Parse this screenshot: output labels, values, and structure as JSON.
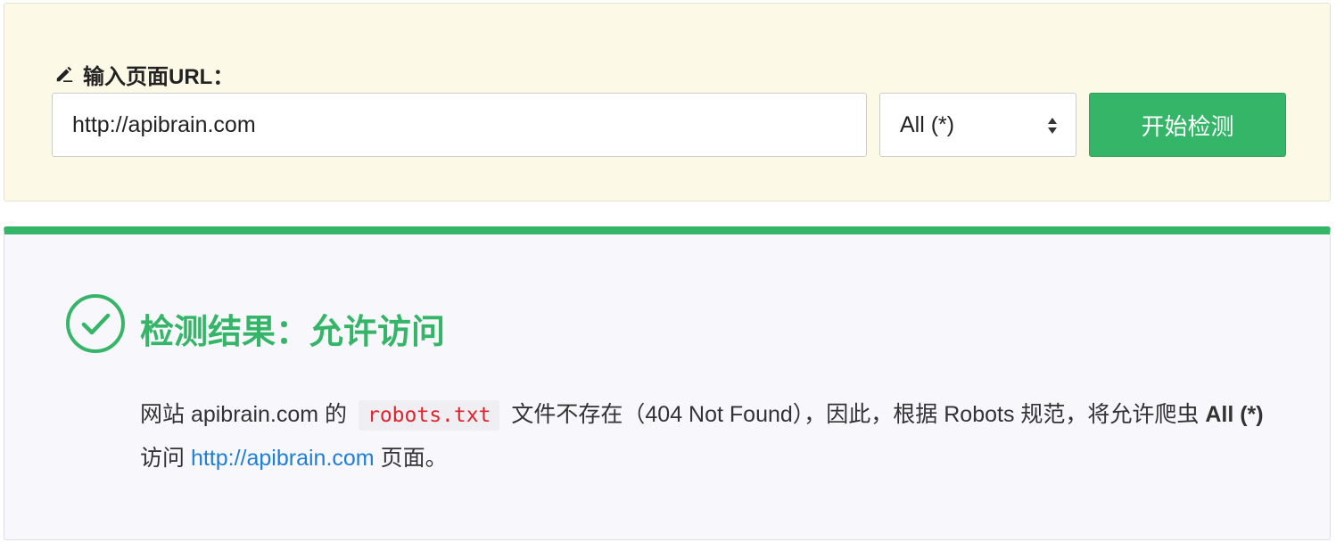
{
  "form": {
    "label": "输入页面URL：",
    "url_value": "http://apibrain.com",
    "user_agent_selected": "All (*)",
    "submit_label": "开始检测"
  },
  "result": {
    "title": "检测结果：允许访问",
    "status": "allowed",
    "description": {
      "prefix": "网站 apibrain.com 的 ",
      "code": "robots.txt",
      "middle": " 文件不存在（404 Not Found），因此，根据 Robots 规范，将允许爬虫 ",
      "agent": "All (*)",
      "after_agent": " 访问 ",
      "link": "http://apibrain.com",
      "suffix": " 页面。"
    }
  },
  "colors": {
    "accent_green": "#35b567",
    "link_blue": "#1e7fd6",
    "code_red": "#e0242c",
    "form_bg": "#fdf9e7",
    "result_bg": "#f7f7fc"
  },
  "icons": {
    "label_icon": "pencil-icon",
    "result_icon": "check-circle-icon",
    "select_icon": "sort-arrows-icon"
  }
}
